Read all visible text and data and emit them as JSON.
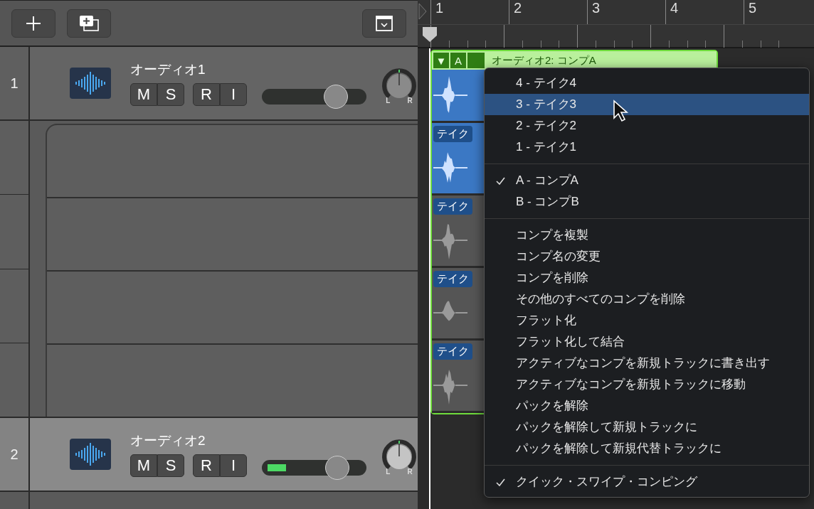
{
  "ruler": {
    "bars": [
      "1",
      "2",
      "3",
      "4",
      "5"
    ]
  },
  "tracks": [
    {
      "number": "1",
      "name": "オーディオ1",
      "selected": false,
      "buttons": [
        "M",
        "S",
        "R",
        "I"
      ],
      "volume": {
        "level": 0.71
      },
      "meter": {
        "level": 0
      },
      "pan_labels": [
        "L",
        "R"
      ]
    },
    {
      "number": "2",
      "name": "オーディオ2",
      "selected": true,
      "buttons": [
        "M",
        "S",
        "R",
        "I"
      ],
      "volume": {
        "level": 0.72
      },
      "meter": {
        "level": 0.18
      },
      "pan_labels": [
        "L",
        "R"
      ]
    }
  ],
  "region": {
    "collapse": "▼",
    "comp_letter": "A",
    "title": "オーディオ2: コンプA",
    "takes": [
      {
        "label": "テイク",
        "selected": true
      },
      {
        "label": "テイク",
        "selected": false
      },
      {
        "label": "テイク",
        "selected": false
      },
      {
        "label": "テイク",
        "selected": false
      }
    ]
  },
  "menu": {
    "sections": [
      {
        "items": [
          {
            "label": "4 - テイク4",
            "selected": false,
            "checked": false
          },
          {
            "label": "3 - テイク3",
            "selected": true,
            "checked": false
          },
          {
            "label": "2 - テイク2",
            "selected": false,
            "checked": false
          },
          {
            "label": "1 - テイク1",
            "selected": false,
            "checked": false
          }
        ]
      },
      {
        "items": [
          {
            "label": "A - コンプA",
            "selected": false,
            "checked": true
          },
          {
            "label": "B - コンプB",
            "selected": false,
            "checked": false
          }
        ]
      },
      {
        "items": [
          {
            "label": "コンプを複製",
            "selected": false,
            "checked": false
          },
          {
            "label": "コンプ名の変更",
            "selected": false,
            "checked": false
          },
          {
            "label": "コンプを削除",
            "selected": false,
            "checked": false
          },
          {
            "label": "その他のすべてのコンプを削除",
            "selected": false,
            "checked": false
          },
          {
            "label": "フラット化",
            "selected": false,
            "checked": false
          },
          {
            "label": "フラット化して結合",
            "selected": false,
            "checked": false
          },
          {
            "label": "アクティブなコンプを新規トラックに書き出す",
            "selected": false,
            "checked": false
          },
          {
            "label": "アクティブなコンプを新規トラックに移動",
            "selected": false,
            "checked": false
          },
          {
            "label": "パックを解除",
            "selected": false,
            "checked": false
          },
          {
            "label": "パックを解除して新規トラックに",
            "selected": false,
            "checked": false
          },
          {
            "label": "パックを解除して新規代替トラックに",
            "selected": false,
            "checked": false
          }
        ]
      },
      {
        "items": [
          {
            "label": "クイック・スワイプ・コンピング",
            "selected": false,
            "checked": true
          }
        ]
      }
    ]
  }
}
